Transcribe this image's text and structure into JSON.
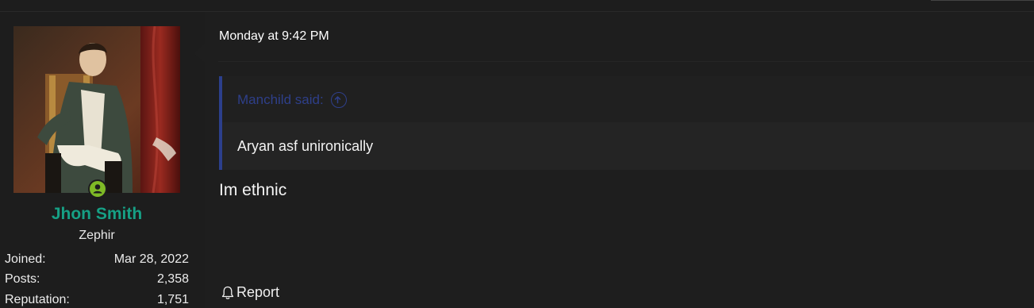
{
  "user": {
    "name": "Jhon Smith",
    "title": "Zephir",
    "online": true,
    "stats": [
      {
        "label": "Joined:",
        "value": "Mar 28, 2022"
      },
      {
        "label": "Posts:",
        "value": "2,358"
      },
      {
        "label": "Reputation:",
        "value": "1,751"
      }
    ]
  },
  "post": {
    "date": "Monday at 9:42 PM",
    "quote": {
      "author_label": "Manchild said:",
      "text": "Aryan asf unironically"
    },
    "body": "Im ethnic",
    "actions": {
      "report_label": "Report"
    }
  },
  "colors": {
    "username": "#16a085",
    "quote_accent": "#2c3f8c",
    "online": "#7fba26"
  }
}
